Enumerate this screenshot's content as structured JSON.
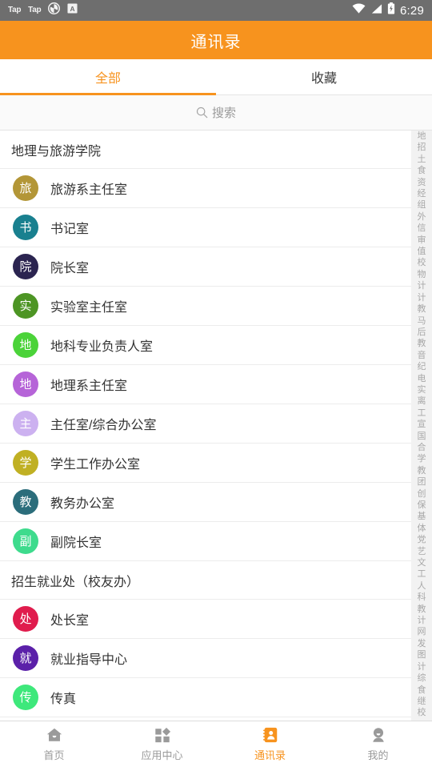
{
  "statusbar": {
    "left_badges": [
      "Tap",
      "Tap"
    ],
    "icons": [
      "shutter-icon",
      "a-app-icon",
      "wifi-icon",
      "signal-icon",
      "battery-icon"
    ],
    "time": "6:29",
    "bg_color": "#6e6e6e"
  },
  "header": {
    "title": "通讯录",
    "bg_color": "#f7931e"
  },
  "tabs": {
    "items": [
      {
        "label": "全部",
        "active": true
      },
      {
        "label": "收藏",
        "active": false
      }
    ],
    "active_color": "#f7931e"
  },
  "search": {
    "placeholder": "搜索",
    "value": "",
    "icon": "search-icon"
  },
  "list": [
    {
      "type": "section",
      "label": "地理与旅游学院"
    },
    {
      "type": "row",
      "initial": "旅",
      "label": "旅游系主任室",
      "color": "#b39637"
    },
    {
      "type": "row",
      "initial": "书",
      "label": "书记室",
      "color": "#19808f"
    },
    {
      "type": "row",
      "initial": "院",
      "label": "院长室",
      "color": "#2b2450"
    },
    {
      "type": "row",
      "initial": "实",
      "label": "实验室主任室",
      "color": "#4d9524"
    },
    {
      "type": "row",
      "initial": "地",
      "label": "地科专业负责人室",
      "color": "#4bd339"
    },
    {
      "type": "row",
      "initial": "地",
      "label": "地理系主任室",
      "color": "#b664d8"
    },
    {
      "type": "row",
      "initial": "主",
      "label": "主任室/综合办公室",
      "color": "#ccb1f0"
    },
    {
      "type": "row",
      "initial": "学",
      "label": "学生工作办公室",
      "color": "#c0b023"
    },
    {
      "type": "row",
      "initial": "教",
      "label": "教务办公室",
      "color": "#2b6d7b"
    },
    {
      "type": "row",
      "initial": "副",
      "label": "副院长室",
      "color": "#3edb8d"
    },
    {
      "type": "section",
      "label": "招生就业处（校友办）"
    },
    {
      "type": "row",
      "initial": "处",
      "label": "处长室",
      "color": "#e01c4d"
    },
    {
      "type": "row",
      "initial": "就",
      "label": "就业指导中心",
      "color": "#5b20a9"
    },
    {
      "type": "row",
      "initial": "传",
      "label": "传真",
      "color": "#3ee87b"
    }
  ],
  "index_bar": [
    "地",
    "招",
    "土",
    "食",
    "资",
    "经",
    "组",
    "外",
    "信",
    "审",
    "值",
    "校",
    "物",
    "计",
    "计",
    "教",
    "马",
    "后",
    "教",
    "音",
    "纪",
    "电",
    "实",
    "离",
    "工",
    "宣",
    "国",
    "合",
    "学",
    "教",
    "团",
    "创",
    "保",
    "基",
    "体",
    "党",
    "艺",
    "文",
    "工",
    "人",
    "科",
    "教",
    "计",
    "网",
    "发",
    "图",
    "计",
    "综",
    "食",
    "继",
    "校"
  ],
  "bottom_nav": {
    "items": [
      {
        "label": "首页",
        "icon": "home-icon",
        "active": false
      },
      {
        "label": "应用中心",
        "icon": "grid-apps-icon",
        "active": false
      },
      {
        "label": "通讯录",
        "icon": "contacts-icon",
        "active": true
      },
      {
        "label": "我的",
        "icon": "person-icon",
        "active": false
      }
    ],
    "active_color": "#f7931e",
    "inactive_color": "#9a9a9a"
  }
}
